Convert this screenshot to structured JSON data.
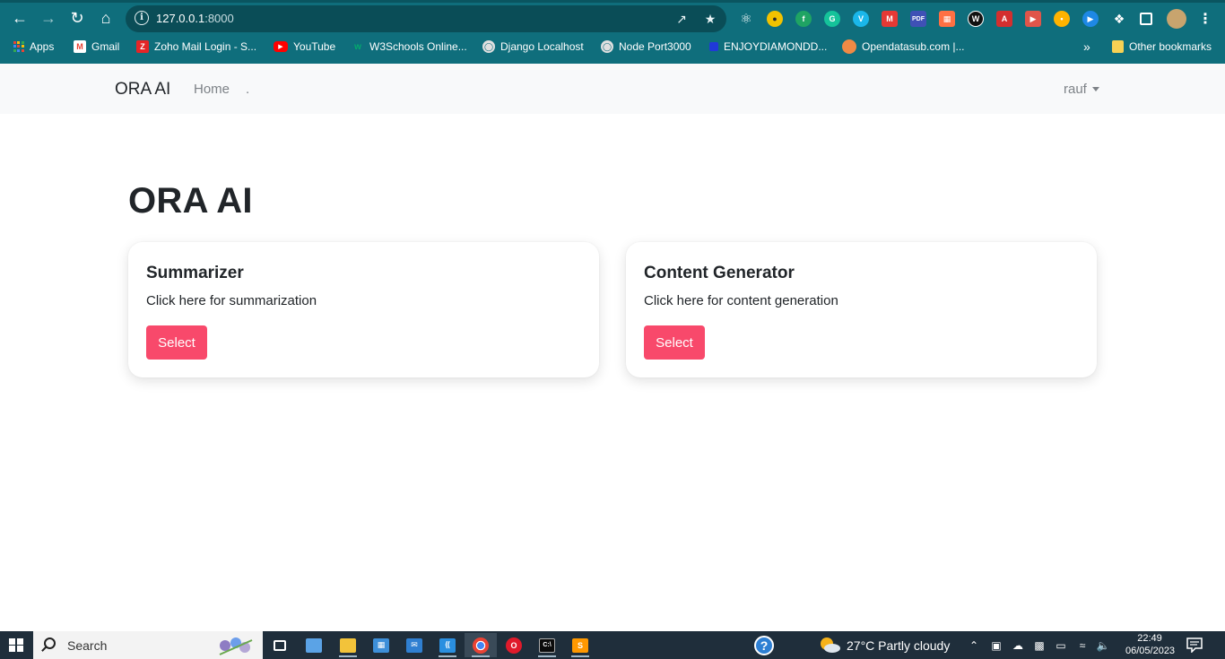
{
  "browser": {
    "url_host": "127.0.0.1",
    "url_port": ":8000",
    "bookmarks": [
      {
        "label": "Apps",
        "icon": "apps-grid-icon"
      },
      {
        "label": "Gmail",
        "icon": "gmail-icon"
      },
      {
        "label": "Zoho Mail Login - S...",
        "icon": "zoho-icon"
      },
      {
        "label": "YouTube",
        "icon": "youtube-icon"
      },
      {
        "label": "W3Schools Online...",
        "icon": "w3schools-icon"
      },
      {
        "label": "Django Localhost",
        "icon": "globe-icon"
      },
      {
        "label": "Node Port3000",
        "icon": "globe-icon"
      },
      {
        "label": "ENJOYDIAMONDD...",
        "icon": "diamond-icon"
      },
      {
        "label": "Opendatasub.com |...",
        "icon": "opendata-icon"
      }
    ],
    "more_bookmarks": "»",
    "other_bookmarks": "Other bookmarks"
  },
  "navbar": {
    "brand": "ORA AI",
    "home": "Home",
    "dot": ".",
    "user": "rauf"
  },
  "main": {
    "title": "ORA AI",
    "cards": [
      {
        "title": "Summarizer",
        "text": "Click here for summarization",
        "button": "Select"
      },
      {
        "title": "Content Generator",
        "text": "Click here for content generation",
        "button": "Select"
      }
    ]
  },
  "taskbar": {
    "search_label": "Search",
    "weather": "27°C  Partly cloudy",
    "time": "22:49",
    "date": "06/05/2023"
  },
  "colors": {
    "chrome": "#0f6e7c",
    "accent_button": "#f8496b",
    "navbar_bg": "#f8f9fa",
    "taskbar": "#1f2e3b"
  }
}
